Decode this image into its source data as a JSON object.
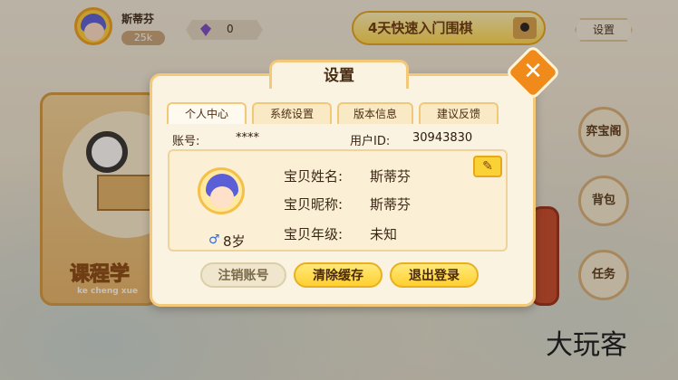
{
  "header": {
    "username": "斯蒂芬",
    "coins": "25k",
    "gems": "0",
    "promo": "4天快速入门围棋",
    "settings_label": "设置"
  },
  "sidebar": {
    "items": [
      "弈宝阁",
      "背包",
      "任务"
    ]
  },
  "course": {
    "title": "课程学",
    "subtitle": "ke cheng xue"
  },
  "modal": {
    "title": "设置",
    "tabs": [
      "个人中心",
      "系统设置",
      "版本信息",
      "建议反馈"
    ],
    "active_tab": "个人中心",
    "account_label": "账号:",
    "account_value": "****",
    "user_id_label": "用户ID:",
    "user_id_value": "30943830",
    "gender_icon": "male-icon",
    "age": "8岁",
    "fields": [
      {
        "label": "宝贝姓名:",
        "value": "斯蒂芬"
      },
      {
        "label": "宝贝昵称:",
        "value": "斯蒂芬"
      },
      {
        "label": "宝贝年级:",
        "value": "未知"
      }
    ],
    "buttons": {
      "deactivate": "注销账号",
      "clear_cache": "清除缓存",
      "logout": "退出登录"
    }
  },
  "watermark": "大玩客"
}
